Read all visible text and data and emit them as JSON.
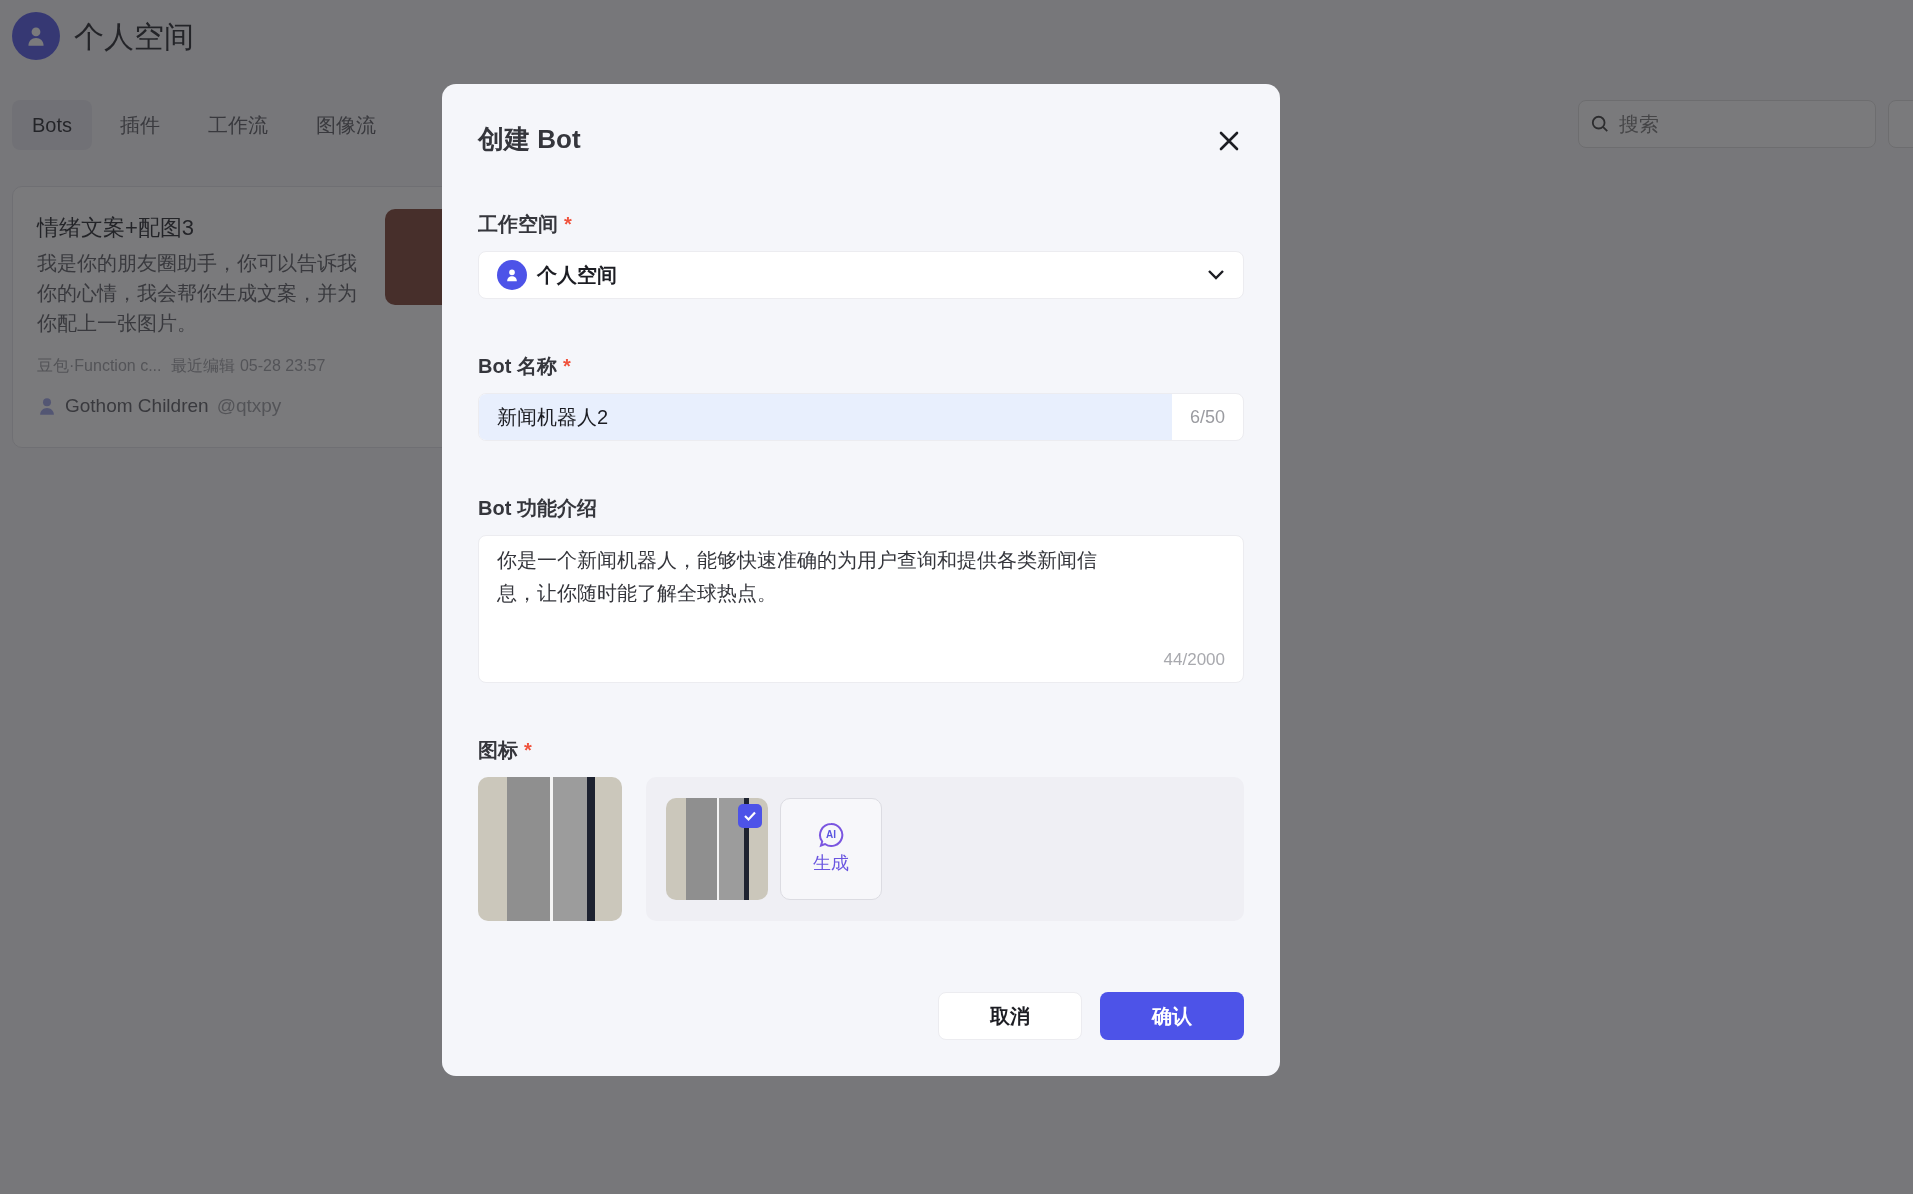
{
  "page": {
    "title": "个人空间",
    "tabs": [
      {
        "label": "Bots",
        "selected": true
      },
      {
        "label": "插件",
        "selected": false
      },
      {
        "label": "工作流",
        "selected": false
      },
      {
        "label": "图像流",
        "selected": false
      }
    ],
    "search": {
      "placeholder": "搜索"
    },
    "cards": [
      {
        "title": "情绪文案+配图3",
        "description": "我是你的朋友圈助手，你可以告诉我你的心情，我会帮你生成文案，并为你配上一张图片。",
        "model": "豆包·Function c...",
        "edited": "最近编辑 05-28 23:57",
        "author": "Gothom Children",
        "handle": "@qtxpy"
      }
    ]
  },
  "dialog": {
    "title": "创建 Bot",
    "workspace": {
      "label": "工作空间",
      "required_mark": "*",
      "value": "个人空间"
    },
    "name": {
      "label": "Bot 名称",
      "required_mark": "*",
      "value": "新闻机器人2",
      "counter": "6/50"
    },
    "description": {
      "label": "Bot 功能介绍",
      "value": "你是一个新闻机器人，能够快速准确的为用户查询和提供各类新闻信息，让你随时能了解全球热点。",
      "counter": "44/2000"
    },
    "icon": {
      "label": "图标",
      "required_mark": "*",
      "options": [
        {
          "kind": "image",
          "selected": true
        },
        {
          "kind": "generate",
          "icon_text": "AI",
          "label": "生成",
          "selected": false
        }
      ]
    },
    "buttons": [
      {
        "kind": "cancel",
        "label": "取消"
      },
      {
        "kind": "confirm",
        "label": "确认"
      }
    ]
  }
}
